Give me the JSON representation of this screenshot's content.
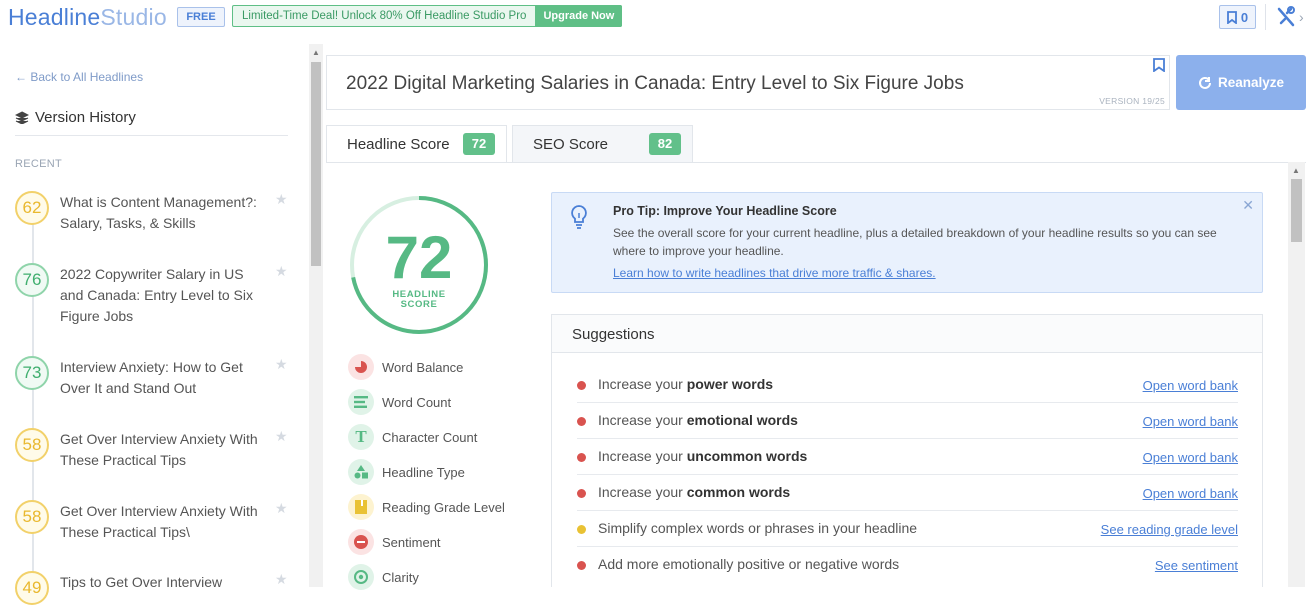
{
  "topbar": {
    "logo_part1": "Headline",
    "logo_part2": "Studio",
    "plan_badge": "FREE",
    "deal_text": "Limited-Time Deal! Unlock 80% Off Headline Studio Pro",
    "upgrade_label": "Upgrade Now",
    "bookmark_count": "0",
    "icons": {
      "bookmark": "bookmark-icon",
      "tools": "tools-icon",
      "chevron": "chevron-right-icon"
    }
  },
  "sidebar": {
    "back_label": "← Back to All Headlines",
    "section_title": "Version History",
    "recent_label": "RECENT",
    "items": [
      {
        "score": "62",
        "text": "What is Content Management?: Salary, Tasks, & Skills",
        "color": "yellow"
      },
      {
        "score": "76",
        "text": "2022 Copywriter Salary in US and Canada: Entry Level to Six Figure Jobs",
        "color": "green"
      },
      {
        "score": "73",
        "text": "Interview Anxiety: How to Get Over It and Stand Out",
        "color": "green"
      },
      {
        "score": "58",
        "text": "Get Over Interview Anxiety With These Practical Tips",
        "color": "yellow"
      },
      {
        "score": "58",
        "text": "Get Over Interview Anxiety With These Practical Tips\\",
        "color": "yellow"
      },
      {
        "score": "49",
        "text": "Tips to Get Over Interview",
        "color": "yellow"
      }
    ]
  },
  "editor": {
    "headline": "2022 Digital Marketing Salaries in Canada: Entry Level to Six Figure Jobs",
    "version": "VERSION 19/25",
    "reanalyze_label": "Reanalyze"
  },
  "tabs": [
    {
      "label": "Headline Score",
      "score": "72"
    },
    {
      "label": "SEO Score",
      "score": "82"
    }
  ],
  "score": {
    "value": "72",
    "label_line1": "HEADLINE",
    "label_line2": "SCORE",
    "fraction": 0.72
  },
  "metrics": [
    {
      "label": "Word Balance",
      "icon": "pie-chart-icon"
    },
    {
      "label": "Word Count",
      "icon": "lines-icon"
    },
    {
      "label": "Character Count",
      "icon": "text-t-icon"
    },
    {
      "label": "Headline Type",
      "icon": "shapes-icon"
    },
    {
      "label": "Reading Grade Level",
      "icon": "book-icon"
    },
    {
      "label": "Sentiment",
      "icon": "face-icon"
    },
    {
      "label": "Clarity",
      "icon": "target-icon"
    }
  ],
  "tip": {
    "title": "Pro Tip: Improve Your Headline Score",
    "body": "See the overall score for your current headline, plus a detailed breakdown of your headline results so you can see where to improve your headline.",
    "link": "Learn how to write headlines that drive more traffic & shares."
  },
  "suggestions": {
    "title": "Suggestions",
    "items": [
      {
        "prefix": "Increase your ",
        "bold": "power words",
        "link": "Open word bank",
        "status": "red"
      },
      {
        "prefix": "Increase your ",
        "bold": "emotional words",
        "link": "Open word bank",
        "status": "red"
      },
      {
        "prefix": "Increase your ",
        "bold": "uncommon words",
        "link": "Open word bank",
        "status": "red"
      },
      {
        "prefix": "Increase your ",
        "bold": "common words",
        "link": "Open word bank",
        "status": "red"
      },
      {
        "prefix": "Simplify complex words or phrases in your headline",
        "bold": "",
        "link": "See reading grade level",
        "status": "yellow"
      },
      {
        "prefix": "Add more emotionally positive or negative words",
        "bold": "",
        "link": "See sentiment",
        "status": "red"
      }
    ]
  },
  "colors": {
    "accent": "#4a7fd6",
    "good": "#56b984",
    "warn": "#e9c234",
    "bad": "#d9534f"
  }
}
